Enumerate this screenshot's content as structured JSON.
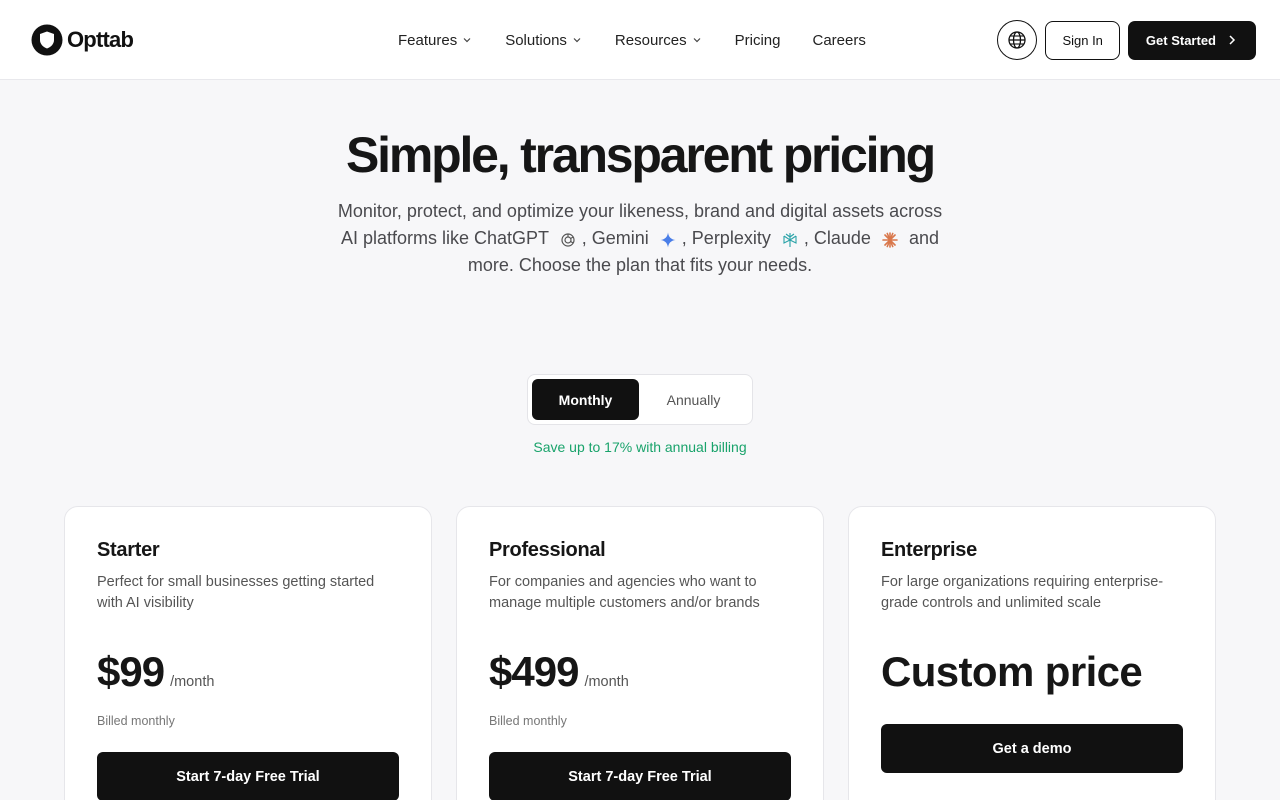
{
  "brand": {
    "name": "Opttab"
  },
  "nav": {
    "items": [
      {
        "label": "Features",
        "has_dropdown": true
      },
      {
        "label": "Solutions",
        "has_dropdown": true
      },
      {
        "label": "Resources",
        "has_dropdown": true
      },
      {
        "label": "Pricing",
        "has_dropdown": false
      },
      {
        "label": "Careers",
        "has_dropdown": false
      }
    ]
  },
  "header_actions": {
    "language_icon": "globe-icon",
    "sign_in": "Sign In",
    "get_started": "Get Started"
  },
  "hero": {
    "title": "Simple, transparent pricing",
    "sub_1": "Monitor, protect, and optimize your likeness, brand and digital assets across AI platforms like ChatGPT",
    "chatgpt_comma": ", Gemini",
    "gemini_comma": ", Perplexity",
    "perplexity_comma": ",",
    "claude": "Claude",
    "sub_end": "and more. Choose the plan that fits your needs."
  },
  "billing": {
    "monthly": "Monthly",
    "annually": "Annually",
    "selected": "Monthly",
    "save_note": "Save up to 17% with annual billing"
  },
  "plans": [
    {
      "name": "Starter",
      "description": "Perfect for small businesses getting started with AI visibility",
      "price": "$99",
      "period": "/month",
      "billed": "Billed monthly",
      "cta": "Start 7-day Free Trial"
    },
    {
      "name": "Professional",
      "description": "For companies and agencies who want to manage multiple customers and/or brands",
      "price": "$499",
      "period": "/month",
      "billed": "Billed monthly",
      "cta": "Start 7-day Free Trial"
    },
    {
      "name": "Enterprise",
      "description": "For large organizations requiring enterprise-grade controls and unlimited scale",
      "price": "Custom price",
      "cta": "Get a demo"
    }
  ],
  "colors": {
    "primary": "#111111",
    "accent_green": "#19a36b",
    "background": "#f7f7f9",
    "card": "#ffffff"
  }
}
